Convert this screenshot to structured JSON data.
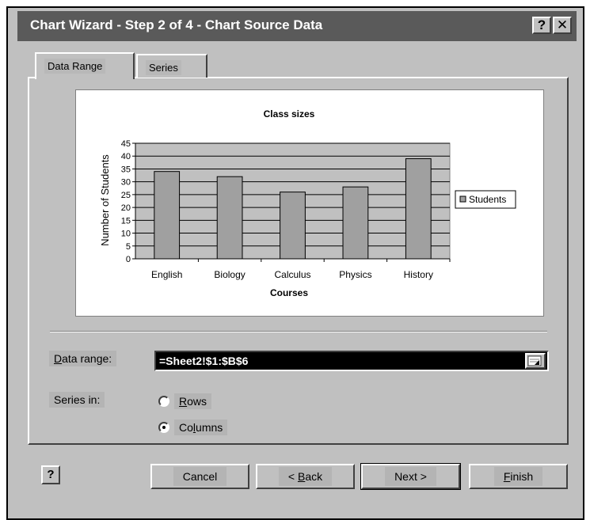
{
  "window": {
    "title": "Chart Wizard - Step 2 of 4 - Chart Source Data",
    "help_glyph": "?",
    "close_glyph": "✕"
  },
  "tabs": [
    {
      "label": "Data Range",
      "active": true
    },
    {
      "label": "Series",
      "active": false
    }
  ],
  "chart_data": {
    "type": "bar",
    "title": "Class sizes",
    "xlabel": "Courses",
    "ylabel": "Number of Students",
    "categories": [
      "English",
      "Biology",
      "Calculus",
      "Physics",
      "History"
    ],
    "series": [
      {
        "name": "Students",
        "values": [
          34,
          32,
          26,
          28,
          39
        ]
      }
    ],
    "ylim": [
      0,
      45
    ],
    "yticks": [
      0,
      5,
      10,
      15,
      20,
      25,
      30,
      35,
      40,
      45
    ],
    "grid": true,
    "legend": "right",
    "colors": {
      "bar": "#a0a0a0",
      "plot_bg": "#c0c0c0"
    }
  },
  "data_range": {
    "label_prefix": "D",
    "label_rest": "ata range:",
    "value": "=Sheet2!$1:$B$6"
  },
  "series_in": {
    "label": "Series in:",
    "rows_prefix": "R",
    "rows_rest": "ows",
    "cols_prefix": "Co",
    "cols_u": "l",
    "cols_rest": "umns",
    "selected": "Columns"
  },
  "buttons": {
    "help": "?",
    "cancel": "Cancel",
    "back_prefix": "< ",
    "back_u": "B",
    "back_rest": "ack",
    "next": "Next >",
    "finish_u": "F",
    "finish_rest": "inish"
  }
}
